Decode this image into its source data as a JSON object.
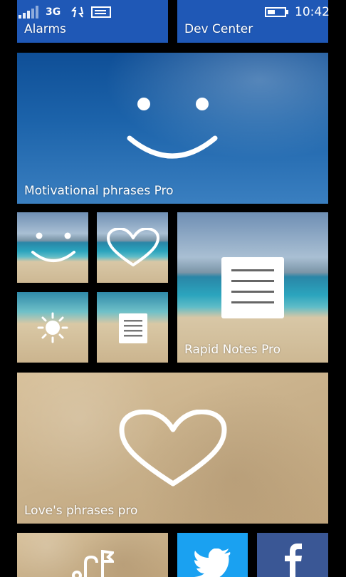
{
  "status_bar": {
    "network": "3G",
    "time": "10:42"
  },
  "tiles": {
    "alarms": {
      "label": "Alarms"
    },
    "dev_center": {
      "label": "Dev Center"
    },
    "motivational": {
      "label": "Motivational phrases Pro"
    },
    "rapid_notes": {
      "label": "Rapid Notes Pro"
    },
    "loves": {
      "label": "Love's phrases pro"
    }
  },
  "icons": {
    "motivational": "smile-icon",
    "loves": "heart-icon",
    "rapid_notes": "notes-icon",
    "brightness": "sun-icon",
    "twitter": "twitter-bird-icon",
    "facebook": "facebook-f-icon"
  },
  "colors": {
    "tile_blue": "#1f58b6",
    "twitter": "#1aa1f1",
    "facebook": "#3a5795"
  }
}
